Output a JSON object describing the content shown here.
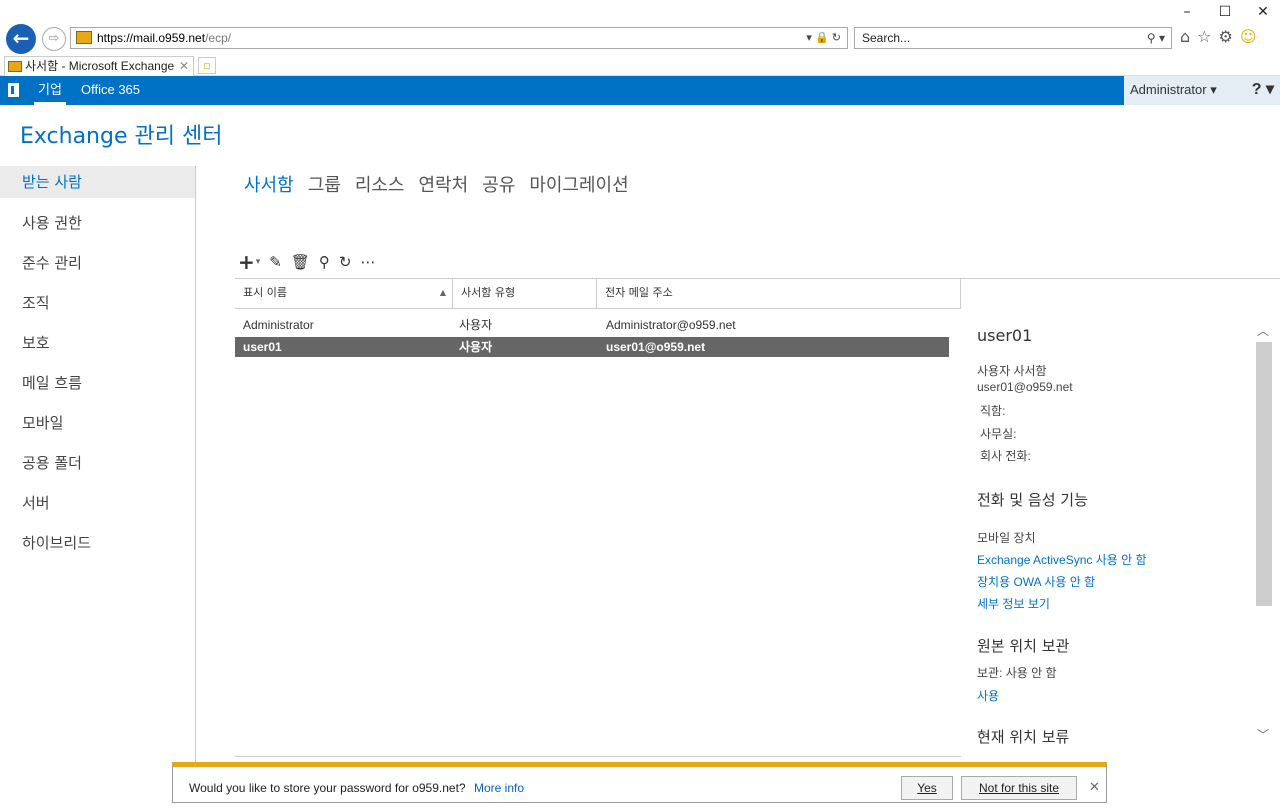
{
  "browser": {
    "url_host": "https://mail.o959.net",
    "url_path": "/ecp/",
    "search_placeholder": "Search...",
    "tab_title": "사서함 - Microsoft Exchange",
    "window_min": "–",
    "window_max": "☐",
    "window_close": "✕"
  },
  "o365": {
    "nav_enterprise": "기업",
    "nav_office365": "Office 365",
    "user": "Administrator ▾",
    "help": "? ▾"
  },
  "app_title": "Exchange 관리 센터",
  "leftnav": [
    {
      "label": "받는 사람",
      "active": true
    },
    {
      "label": "사용 권한"
    },
    {
      "label": "준수 관리"
    },
    {
      "label": "조직"
    },
    {
      "label": "보호"
    },
    {
      "label": "메일 흐름"
    },
    {
      "label": "모바일"
    },
    {
      "label": "공용 폴더"
    },
    {
      "label": "서버"
    },
    {
      "label": "하이브리드"
    }
  ],
  "subtabs": [
    "사서함",
    "그룹",
    "리소스",
    "연락처",
    "공유",
    "마이그레이션"
  ],
  "grid": {
    "columns": [
      "표시 이름",
      "사서함 유형",
      "전자 메일 주소"
    ],
    "rows": [
      {
        "name": "Administrator",
        "type": "사용자",
        "email": "Administrator@o959.net"
      },
      {
        "name": "user01",
        "type": "사용자",
        "email": "user01@o959.net",
        "selected": true
      }
    ]
  },
  "detail": {
    "title": "user01",
    "kind": "사용자 사서함",
    "email": "user01@o959.net",
    "job_title": "직함:",
    "office": "사무실:",
    "company_phone": "회사 전화:",
    "section_phone": "전화 및 음성 기능",
    "mobile_devices": "모바일 장치",
    "activesync": "Exchange ActiveSync 사용 안 함",
    "owa_devices": "장치용 OWA 사용 안 함",
    "view_details": "세부 정보 보기",
    "section_hold": "원본 위치 보관",
    "hold_status": "보관: 사용 안 함",
    "enable": "사용",
    "section_inplace": "현재 위치 보류"
  },
  "password_bar": {
    "message": "Would you like to store your password for o959.net?",
    "more_info": "More info",
    "yes": "Yes",
    "not_for_site": "Not for this site"
  }
}
